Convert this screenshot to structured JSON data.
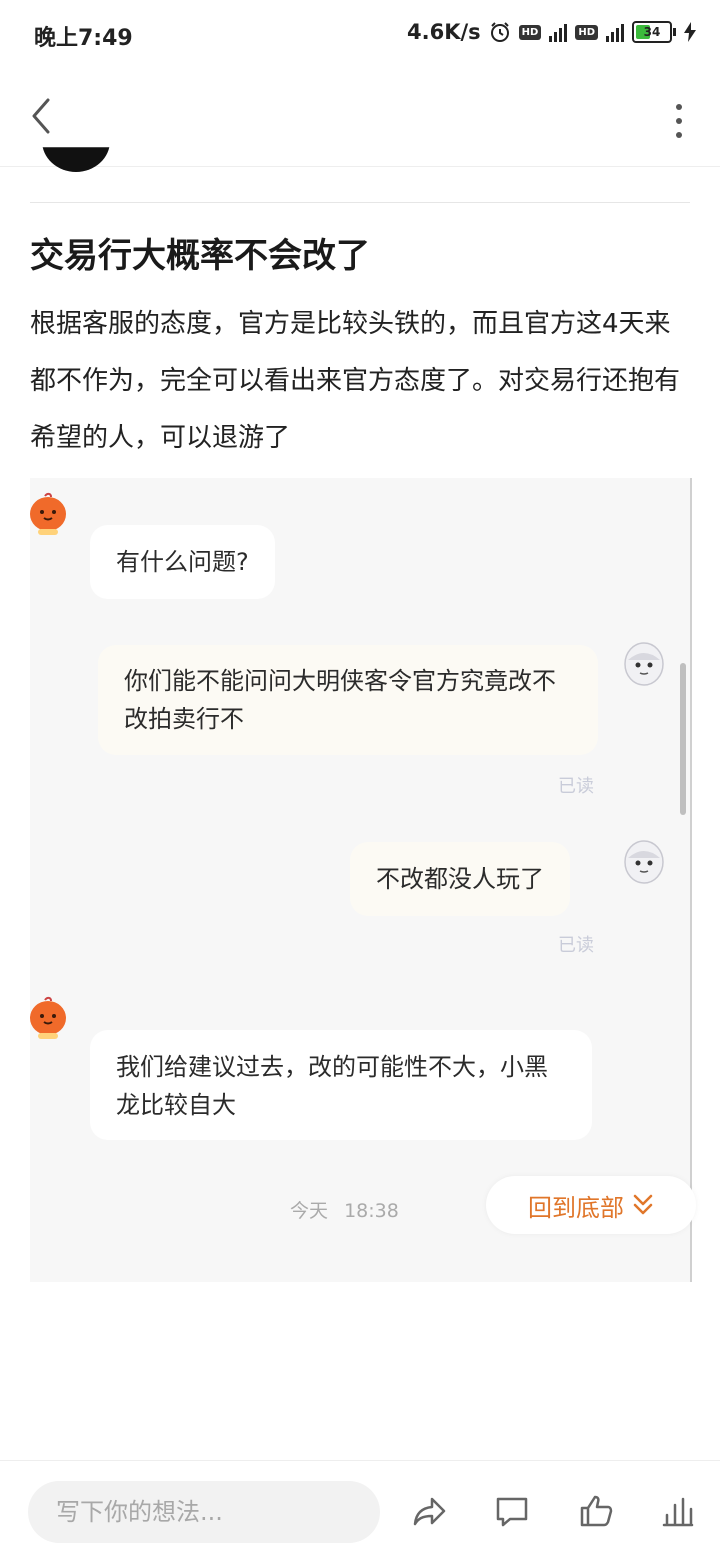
{
  "status": {
    "time": "晚上7:49",
    "speed": "4.6K/s",
    "battery": "34"
  },
  "post": {
    "title": "交易行大概率不会改了",
    "body": "根据客服的态度，官方是比较头铁的，而且官方这4天来都不作为，完全可以看出来官方态度了。对交易行还抱有希望的人，可以退游了"
  },
  "chat": {
    "messages": [
      {
        "side": "left",
        "text": "有什么问题?"
      },
      {
        "side": "right",
        "text": "你们能不能问问大明侠客令官方究竟改不改拍卖行不"
      },
      {
        "side": "right",
        "text": "不改都没人玩了"
      },
      {
        "side": "left",
        "text": "我们给建议过去，改的可能性不大，小黑龙比较自大"
      }
    ],
    "read_label": "已读",
    "time_label": "今天",
    "time_value": "18:38",
    "back_to_bottom": "回到底部"
  },
  "bottom": {
    "input_placeholder": "写下你的想法..."
  },
  "colors": {
    "accent": "#e0762a",
    "read": "#c9ccd9"
  },
  "icons": [
    "back-icon",
    "more-icon",
    "share-icon",
    "comment-icon",
    "like-icon",
    "stats-icon"
  ]
}
